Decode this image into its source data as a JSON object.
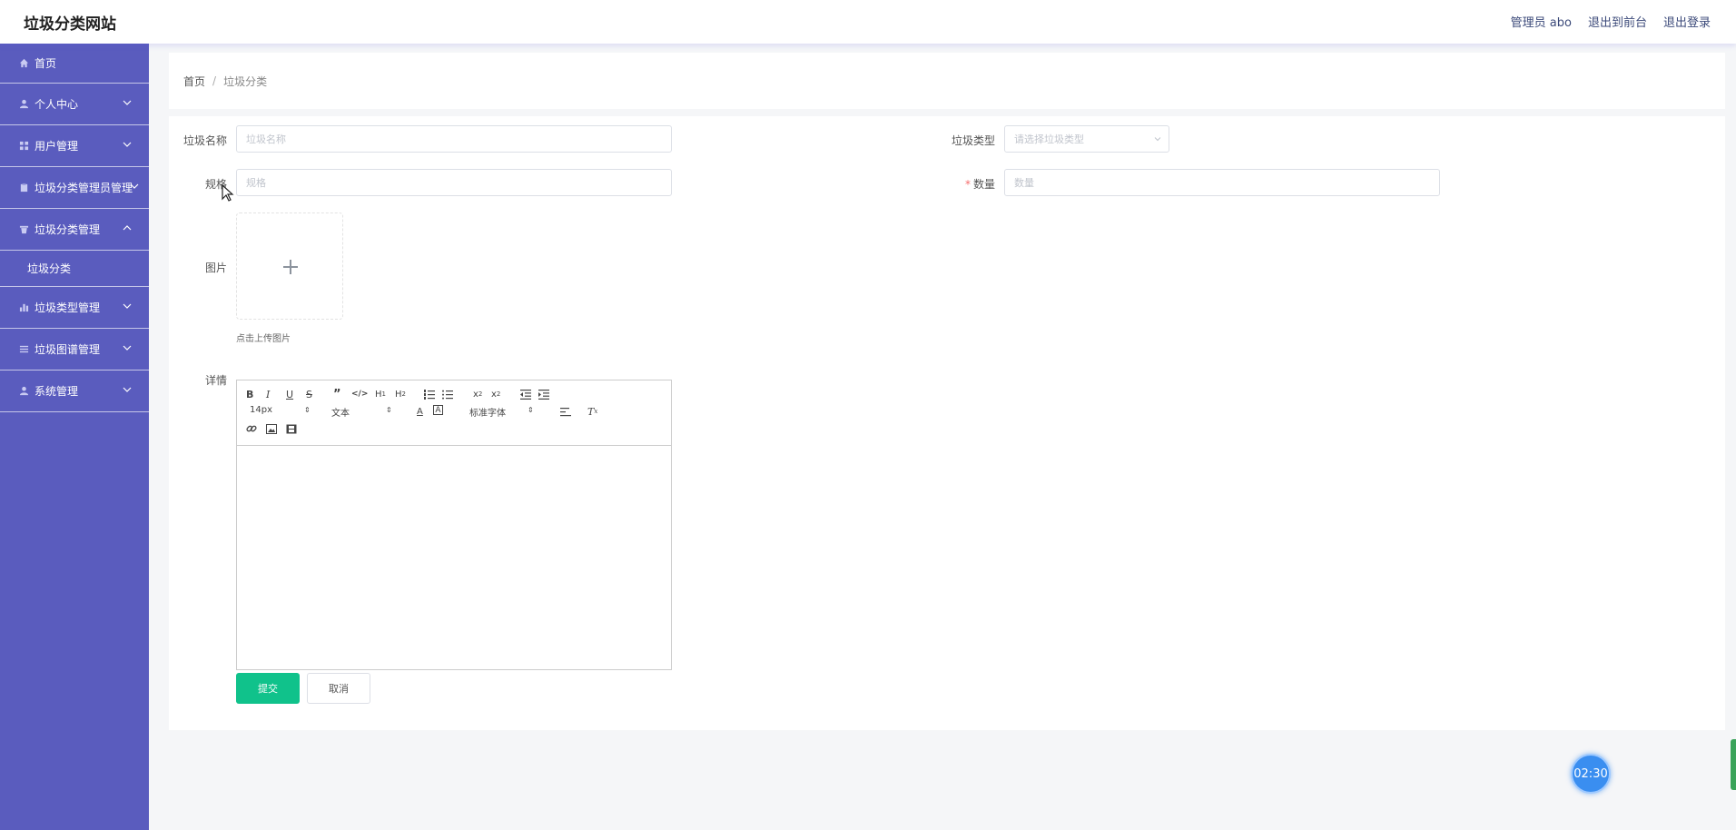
{
  "app": {
    "title": "垃圾分类网站"
  },
  "header": {
    "user": "管理员 abo",
    "front": "退出到前台",
    "logout": "退出登录"
  },
  "sidebar": {
    "items": [
      {
        "label": "首页",
        "icon": "home-icon"
      },
      {
        "label": "个人中心",
        "icon": "user-icon"
      },
      {
        "label": "用户管理",
        "icon": "grid-icon"
      },
      {
        "label": "垃圾分类管理员管理",
        "icon": "clipboard-icon"
      },
      {
        "label": "垃圾分类管理",
        "icon": "trash-icon",
        "expanded": true,
        "children": [
          {
            "label": "垃圾分类"
          }
        ]
      },
      {
        "label": "垃圾类型管理",
        "icon": "bar-chart-icon"
      },
      {
        "label": "垃圾图谱管理",
        "icon": "list-icon"
      },
      {
        "label": "系统管理",
        "icon": "person-icon"
      }
    ]
  },
  "breadcrumb": {
    "home": "首页",
    "separator": "/",
    "current": "垃圾分类"
  },
  "form": {
    "name_label": "垃圾名称",
    "name_placeholder": "垃圾名称",
    "type_label": "垃圾类型",
    "type_placeholder": "请选择垃圾类型",
    "spec_label": "规格",
    "spec_placeholder": "规格",
    "qty_required": "*",
    "qty_label": "数量",
    "qty_placeholder": "数量",
    "image_label": "图片",
    "upload_hint": "点击上传图片",
    "detail_label": "详情",
    "submit": "提交",
    "cancel": "取消"
  },
  "editor": {
    "size": "14px",
    "header": "文本",
    "font": "标准字体"
  },
  "timer": "02:30",
  "colors": {
    "sidebar": "#5a5cbe",
    "submit": "#10c28b",
    "timer": "#3a8ef0"
  }
}
